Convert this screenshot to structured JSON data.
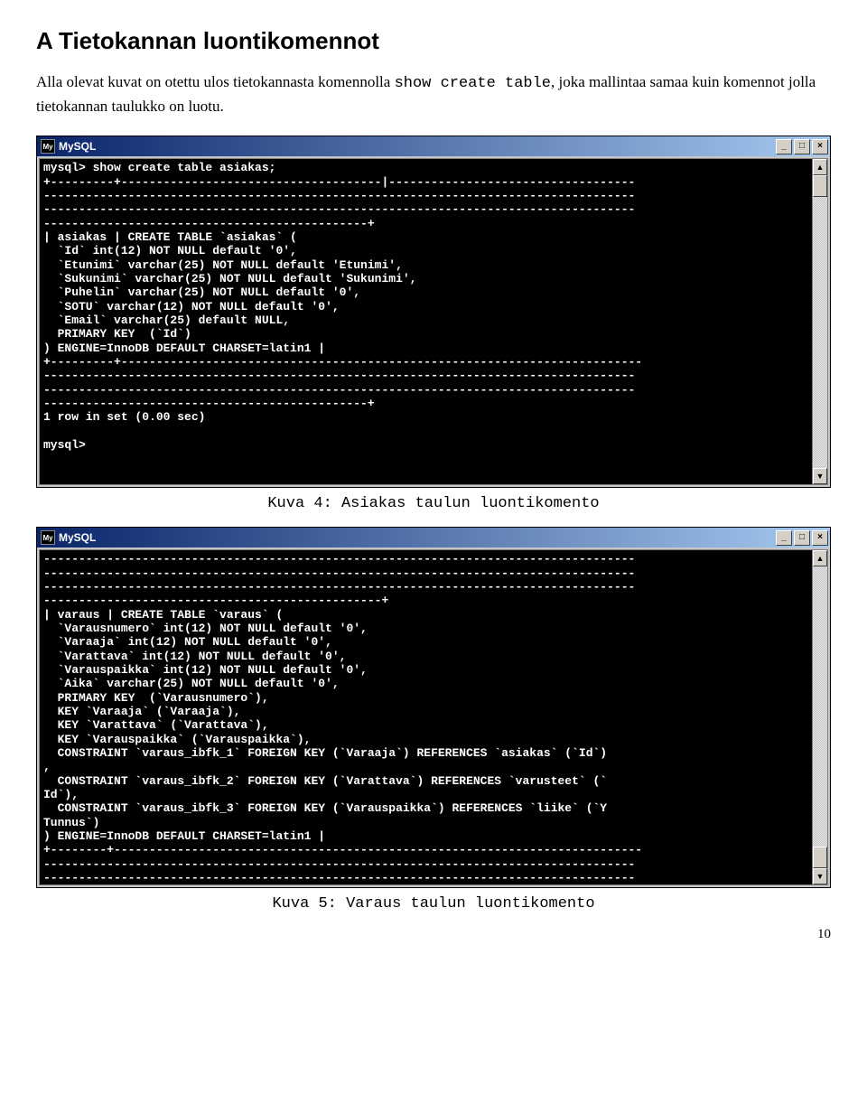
{
  "heading": "A Tietokannan luontikomennot",
  "intro_pre": "Alla olevat kuvat on otettu ulos tietokannasta komennolla ",
  "intro_code": "show create table",
  "intro_post": ", joka mallintaa samaa kuin komennot jolla tietokannan taulukko on luotu.",
  "window": {
    "app_glyph": "My",
    "title": "MySQL",
    "min_glyph": "_",
    "max_glyph": "□",
    "close_glyph": "×",
    "scroll_up_glyph": "▲",
    "scroll_down_glyph": "▼"
  },
  "terminal1": "mysql> show create table asiakas;\n+---------+-------------------------------------|-----------------------------------\n------------------------------------------------------------------------------------\n------------------------------------------------------------------------------------\n----------------------------------------------+\n| asiakas | CREATE TABLE `asiakas` (\n  `Id` int(12) NOT NULL default '0',\n  `Etunimi` varchar(25) NOT NULL default 'Etunimi',\n  `Sukunimi` varchar(25) NOT NULL default 'Sukunimi',\n  `Puhelin` varchar(25) NOT NULL default '0',\n  `SOTU` varchar(12) NOT NULL default '0',\n  `Email` varchar(25) default NULL,\n  PRIMARY KEY  (`Id`)\n) ENGINE=InnoDB DEFAULT CHARSET=latin1 |\n+---------+--------------------------------------------------------------------------\n------------------------------------------------------------------------------------\n------------------------------------------------------------------------------------\n----------------------------------------------+\n1 row in set (0.00 sec)\n\nmysql>",
  "terminal2": "------------------------------------------------------------------------------------\n------------------------------------------------------------------------------------\n------------------------------------------------------------------------------------\n------------------------------------------------+\n| varaus | CREATE TABLE `varaus` (\n  `Varausnumero` int(12) NOT NULL default '0',\n  `Varaaja` int(12) NOT NULL default '0',\n  `Varattava` int(12) NOT NULL default '0',\n  `Varauspaikka` int(12) NOT NULL default '0',\n  `Aika` varchar(25) NOT NULL default '0',\n  PRIMARY KEY  (`Varausnumero`),\n  KEY `Varaaja` (`Varaaja`),\n  KEY `Varattava` (`Varattava`),\n  KEY `Varauspaikka` (`Varauspaikka`),\n  CONSTRAINT `varaus_ibfk_1` FOREIGN KEY (`Varaaja`) REFERENCES `asiakas` (`Id`)\n,\n  CONSTRAINT `varaus_ibfk_2` FOREIGN KEY (`Varattava`) REFERENCES `varusteet` (`\nId`),\n  CONSTRAINT `varaus_ibfk_3` FOREIGN KEY (`Varauspaikka`) REFERENCES `liike` (`Y\nTunnus`)\n) ENGINE=InnoDB DEFAULT CHARSET=latin1 |\n+--------+---------------------------------------------------------------------------\n------------------------------------------------------------------------------------\n------------------------------------------------------------------------------------",
  "caption1": "Kuva 4: Asiakas taulun luontikomento",
  "caption2": "Kuva 5: Varaus taulun luontikomento",
  "page_number": "10"
}
